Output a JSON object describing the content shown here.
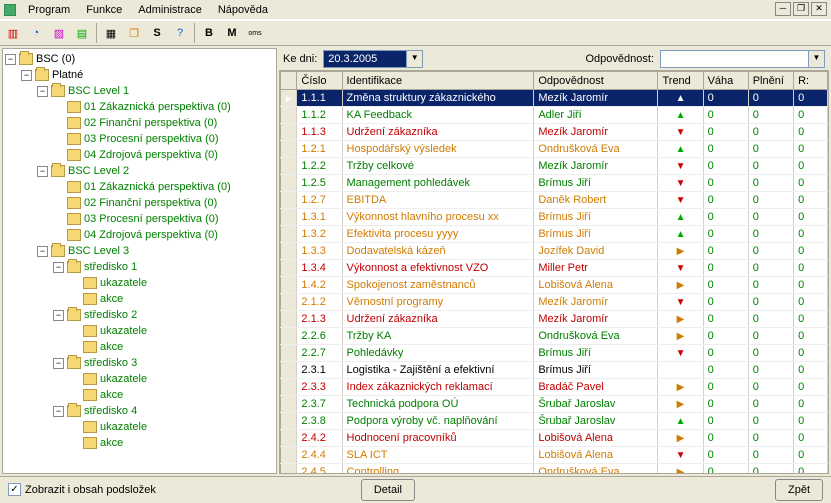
{
  "menu": {
    "items": [
      "Program",
      "Funkce",
      "Administrace",
      "Nápověda"
    ]
  },
  "toolbar_icons": [
    "chart-bar",
    "chart-pie",
    "chart-line",
    "chart-area",
    "grid",
    "chat",
    "S",
    "help",
    "B",
    "M",
    "oms"
  ],
  "tree": {
    "root": "BSC (0)",
    "platne": "Platné",
    "levels": [
      {
        "name": "BSC Level 1",
        "items": [
          "01 Zákaznická perspektiva (0)",
          "02 Finanční perspektiva (0)",
          "03 Procesní perspektiva (0)",
          "04 Zdrojová perspektiva (0)"
        ]
      },
      {
        "name": "BSC Level 2",
        "items": [
          "01 Zákaznická perspektiva (0)",
          "02 Finanční perspektiva (0)",
          "03 Procesní perspektiva (0)",
          "04 Zdrojová perspektiva (0)"
        ]
      },
      {
        "name": "BSC Level 3",
        "strediska": [
          {
            "name": "středisko 1",
            "sub": [
              "ukazatele",
              "akce"
            ]
          },
          {
            "name": "středisko 2",
            "sub": [
              "ukazatele",
              "akce"
            ]
          },
          {
            "name": "středisko 3",
            "sub": [
              "ukazatele",
              "akce"
            ]
          },
          {
            "name": "středisko 4",
            "sub": [
              "ukazatele",
              "akce"
            ]
          }
        ]
      }
    ]
  },
  "filter": {
    "date_label": "Ke dni:",
    "date_value": "20.3.2005",
    "resp_label": "Odpovědnost:"
  },
  "cols": [
    "",
    "Číslo",
    "Identifikace",
    "Odpovědnost",
    "Trend",
    "Váha",
    "Plnění",
    "R:"
  ],
  "rows": [
    {
      "n": "1.1.1",
      "id": "Změna struktury zákaznického",
      "r": "Mezík Jaromír",
      "t": "up",
      "c": "green",
      "sel": true
    },
    {
      "n": "1.1.2",
      "id": "KA Feedback",
      "r": "Adler Jiří",
      "t": "up",
      "c": "green"
    },
    {
      "n": "1.1.3",
      "id": "Udržení zákazníka",
      "r": "Mezík Jaromír",
      "t": "down",
      "c": "red"
    },
    {
      "n": "1.2.1",
      "id": "Hospodářský výsledek",
      "r": "Ondrušková Eva",
      "t": "up",
      "c": "orange"
    },
    {
      "n": "1.2.2",
      "id": "Tržby celkové",
      "r": "Mezík Jaromír",
      "t": "down",
      "c": "green"
    },
    {
      "n": "1.2.5",
      "id": "Management pohledávek",
      "r": "Brímus Jiří",
      "t": "down",
      "c": "green"
    },
    {
      "n": "1.2.7",
      "id": "EBITDA",
      "r": "Daněk Robert",
      "t": "down",
      "c": "orange"
    },
    {
      "n": "1.3.1",
      "id": "Výkonnost hlavního procesu xx",
      "r": "Brímus Jiří",
      "t": "up",
      "c": "orange"
    },
    {
      "n": "1.3.2",
      "id": "Efektivita procesu yyyy",
      "r": "Brímus Jiří",
      "t": "up",
      "c": "orange"
    },
    {
      "n": "1.3.3",
      "id": "Dodavatelská kázeň",
      "r": "Jozífek David",
      "t": "right",
      "c": "orange"
    },
    {
      "n": "1.3.4",
      "id": "Výkonnost a efektivnost VZO",
      "r": "Miller Petr",
      "t": "down",
      "c": "red"
    },
    {
      "n": "1.4.2",
      "id": "Spokojenost zaměstnanců",
      "r": "Lobišová Alena",
      "t": "right",
      "c": "orange"
    },
    {
      "n": "2.1.2",
      "id": "Věrnostní programy",
      "r": "Mezík Jaromír",
      "t": "down",
      "c": "orange"
    },
    {
      "n": "2.1.3",
      "id": "Udržení zákazníka",
      "r": "Mezík Jaromír",
      "t": "right",
      "c": "red"
    },
    {
      "n": "2.2.6",
      "id": "Tržby KA",
      "r": "Ondrušková Eva",
      "t": "right",
      "c": "green"
    },
    {
      "n": "2.2.7",
      "id": "Pohledávky",
      "r": "Brímus Jiří",
      "t": "down",
      "c": "green"
    },
    {
      "n": "2.3.1",
      "id": "Logistika - Zajištění a efektivní",
      "r": "Brímus Jiří",
      "t": "",
      "c": "black"
    },
    {
      "n": "2.3.3",
      "id": "Index zákaznických reklamací",
      "r": "Bradáč Pavel",
      "t": "right",
      "c": "red"
    },
    {
      "n": "2.3.7",
      "id": "Technická podpora OÚ",
      "r": "Šrubař Jaroslav",
      "t": "right",
      "c": "green"
    },
    {
      "n": "2.3.8",
      "id": "Podpora výroby vč. naplňování",
      "r": "Šrubař Jaroslav",
      "t": "up",
      "c": "green"
    },
    {
      "n": "2.4.2",
      "id": "Hodnocení pracovníků",
      "r": "Lobišová Alena",
      "t": "right",
      "c": "red"
    },
    {
      "n": "2.4.4",
      "id": "SLA ICT",
      "r": "Lobišová Alena",
      "t": "down",
      "c": "orange"
    },
    {
      "n": "2.4.5",
      "id": "Controlling",
      "r": "Ondrušková Eva",
      "t": "right",
      "c": "orange"
    }
  ],
  "footer": {
    "checkbox": "Zobrazit i obsah podsložek",
    "detail": "Detail",
    "back": "Zpět"
  }
}
